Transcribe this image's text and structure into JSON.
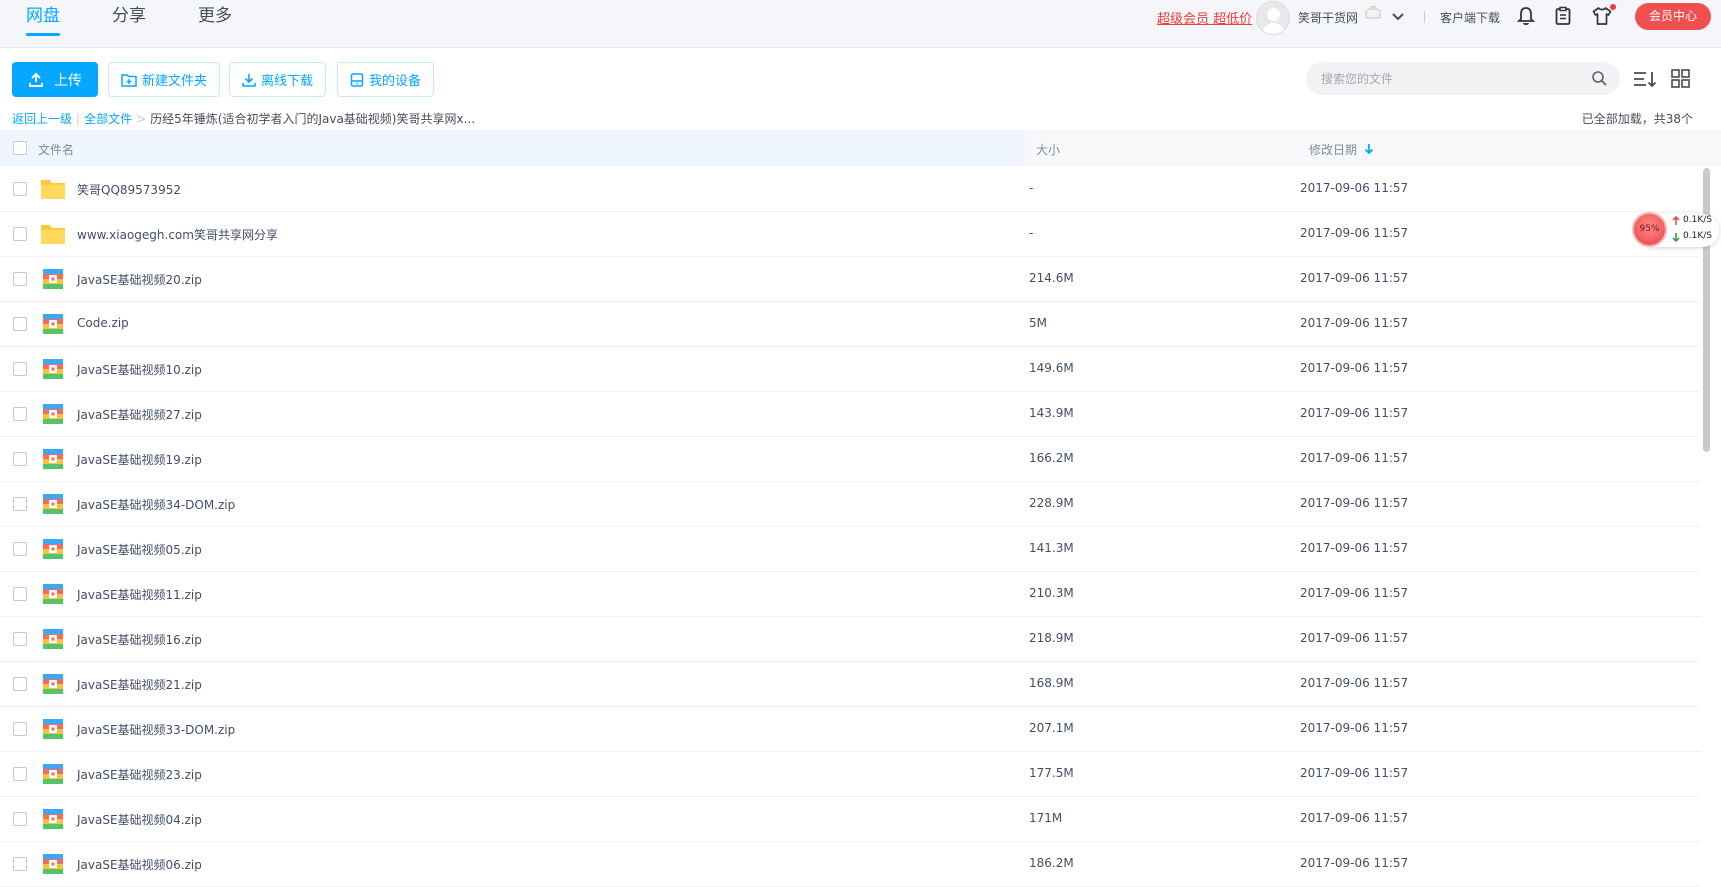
{
  "nav": {
    "tabs": [
      {
        "label": "网盘",
        "active": true
      },
      {
        "label": "分享",
        "active": false
      },
      {
        "label": "更多",
        "active": false
      }
    ]
  },
  "header": {
    "vip_link": "超级会员 超低价",
    "username": "笑哥干货网",
    "client_download": "客户端下载",
    "member_center": "会员中心",
    "icons": [
      "bell-icon",
      "clipboard-icon",
      "tshirt-icon"
    ]
  },
  "toolbar": {
    "upload": "上传",
    "new_folder": "新建文件夹",
    "offline_download": "离线下载",
    "my_devices": "我的设备",
    "search_placeholder": "搜索您的文件"
  },
  "breadcrumb": {
    "back": "返回上一级",
    "all_files": "全部文件",
    "separator": ">",
    "current": "历经5年锤炼(适合初学者入门的Java基础视频)笑哥共享网x..."
  },
  "loaded_info": "已全部加载，共38个",
  "columns": {
    "name": "文件名",
    "size": "大小",
    "date": "修改日期"
  },
  "files": [
    {
      "name": "笑哥QQ89573952",
      "type": "folder",
      "size": "-",
      "date": "2017-09-06 11:57"
    },
    {
      "name": "www.xiaogegh.com笑哥共享网分享",
      "type": "folder",
      "size": "-",
      "date": "2017-09-06 11:57"
    },
    {
      "name": "JavaSE基础视频20.zip",
      "type": "zip",
      "size": "214.6M",
      "date": "2017-09-06 11:57"
    },
    {
      "name": "Code.zip",
      "type": "zip",
      "size": "5M",
      "date": "2017-09-06 11:57"
    },
    {
      "name": "JavaSE基础视频10.zip",
      "type": "zip",
      "size": "149.6M",
      "date": "2017-09-06 11:57"
    },
    {
      "name": "JavaSE基础视频27.zip",
      "type": "zip",
      "size": "143.9M",
      "date": "2017-09-06 11:57"
    },
    {
      "name": "JavaSE基础视频19.zip",
      "type": "zip",
      "size": "166.2M",
      "date": "2017-09-06 11:57"
    },
    {
      "name": "JavaSE基础视频34-DOM.zip",
      "type": "zip",
      "size": "228.9M",
      "date": "2017-09-06 11:57"
    },
    {
      "name": "JavaSE基础视频05.zip",
      "type": "zip",
      "size": "141.3M",
      "date": "2017-09-06 11:57"
    },
    {
      "name": "JavaSE基础视频11.zip",
      "type": "zip",
      "size": "210.3M",
      "date": "2017-09-06 11:57"
    },
    {
      "name": "JavaSE基础视频16.zip",
      "type": "zip",
      "size": "218.9M",
      "date": "2017-09-06 11:57"
    },
    {
      "name": "JavaSE基础视频21.zip",
      "type": "zip",
      "size": "168.9M",
      "date": "2017-09-06 11:57"
    },
    {
      "name": "JavaSE基础视频33-DOM.zip",
      "type": "zip",
      "size": "207.1M",
      "date": "2017-09-06 11:57"
    },
    {
      "name": "JavaSE基础视频23.zip",
      "type": "zip",
      "size": "177.5M",
      "date": "2017-09-06 11:57"
    },
    {
      "name": "JavaSE基础视频04.zip",
      "type": "zip",
      "size": "171M",
      "date": "2017-09-06 11:57"
    },
    {
      "name": "JavaSE基础视频06.zip",
      "type": "zip",
      "size": "186.2M",
      "date": "2017-09-06 11:57"
    }
  ],
  "speed_widget": {
    "percent": "95%",
    "upload": "0.1K/S",
    "download": "0.1K/S"
  },
  "colors": {
    "accent": "#06a7ff",
    "vip_red": "#f33a3a",
    "member_button": "#f04f4f",
    "folder": "#ffd24c"
  }
}
